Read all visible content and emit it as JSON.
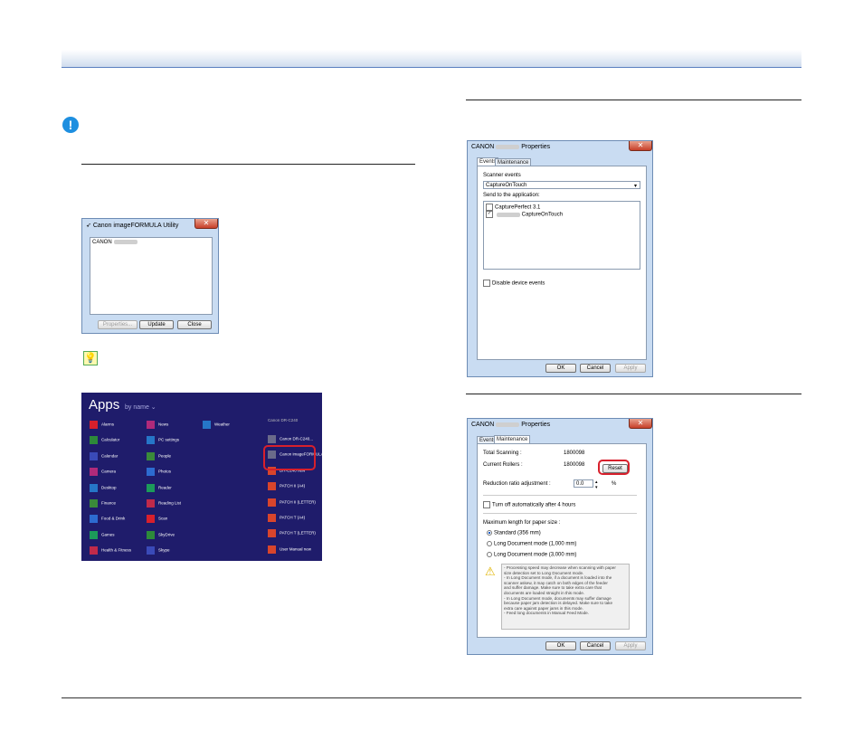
{
  "utility": {
    "title": "Canon imageFORMULA Utility",
    "list_item": "CANON",
    "properties_btn": "Properties...",
    "update_btn": "Update",
    "close_btn": "Close"
  },
  "apps": {
    "title": "Apps",
    "sort": "by name ⌄",
    "group_label": "Canon DR-C240",
    "col1": [
      "Alarms",
      "Calculator",
      "Calendar",
      "Camera",
      "Desktop",
      "Finance",
      "Food & Drink",
      "Games",
      "Health & Fitness"
    ],
    "col2": [
      "News",
      "PC settings",
      "People",
      "Photos",
      "Reader",
      "Reading List",
      "Scan",
      "SkyDrive",
      "Skype"
    ],
    "col3": [
      "Weather"
    ],
    "col4": [
      "Canon DR-C240...",
      "Canon imageFORMULA",
      "DR-C240 new",
      "PATCH II (A4)",
      "PATCH II (LETTER)",
      "PATCH T (A4)",
      "PATCH T (LETTER)",
      "User Manual new"
    ],
    "colors": {
      "bg": "#1f1c6b",
      "highlight": "#d8202c"
    }
  },
  "events_dialog": {
    "title_prefix": "CANON",
    "title_suffix": "Properties",
    "tab_events": "Events",
    "tab_maint": "Maintenance",
    "scanner_events_label": "Scanner events",
    "scanner_events_value": "CaptureOnTouch",
    "send_to_label": "Send to the application:",
    "apps": [
      "CapturePerfect 3.1",
      "CaptureOnTouch"
    ],
    "disable_label": "Disable device events",
    "ok": "OK",
    "cancel": "Cancel",
    "apply": "Apply"
  },
  "maint_dialog": {
    "title_prefix": "CANON",
    "title_suffix": "Properties",
    "tab_events": "Events",
    "tab_maint": "Maintenance",
    "total_label": "Total Scanning :",
    "total_value": "1800098",
    "rollers_label": "Current Rollers :",
    "rollers_value": "1800098",
    "reset_btn": "Reset",
    "reduction_label": "Reduction ratio adjustment :",
    "reduction_value": "0.0",
    "reduction_unit": "%",
    "turnoff_label": "Turn off automatically after 4 hours",
    "maxlen_label": "Maximum length for paper size :",
    "options": [
      "Standard (356 mm)",
      "Long Document mode (1,000 mm)",
      "Long Document mode (3,000 mm)"
    ],
    "warning": [
      "- Processing speed may decrease when scanning with paper",
      "size detection set to Long Document mode.",
      "- In Long Document mode, if a document is loaded into the",
      "scanner askew, it may catch on both edges of the feeder",
      "and suffer damage. Make sure to take extra care that",
      "documents are loaded straight in this mode.",
      "- In Long Document mode, documents may suffer damage",
      "because paper jam detection is delayed. Make sure to take",
      "extra care against paper jams in this mode.",
      "- Feed long documents in Manual Feed Mode."
    ],
    "ok": "OK",
    "cancel": "Cancel",
    "apply": "Apply"
  },
  "icons": {
    "caution": "!",
    "hint": "lightbulb"
  }
}
